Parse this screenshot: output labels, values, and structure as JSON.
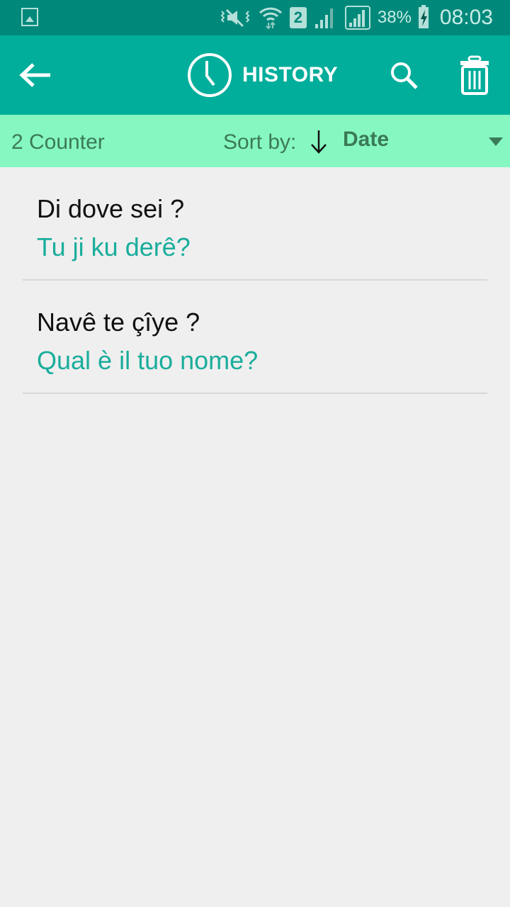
{
  "status_bar": {
    "icons": [
      "gallery-icon",
      "vibrate-mute-icon",
      "wifi-icon",
      "sim-2-icon",
      "signal-icon",
      "signal-full-icon",
      "battery-charging-icon"
    ],
    "sim_label": "2",
    "battery_percent": "38%",
    "time": "08:03"
  },
  "app_bar": {
    "title": "HISTORY",
    "icons": [
      "back-arrow-icon",
      "clock-icon",
      "search-icon",
      "trash-icon"
    ]
  },
  "sort_bar": {
    "counter": "2 Counter",
    "sort_label": "Sort by:",
    "sort_direction": "descending",
    "sort_value": "Date"
  },
  "history": [
    {
      "source": "Di dove sei ?",
      "translation": "Tu ji ku derê?"
    },
    {
      "source": "Navê te çîye ?",
      "translation": "Qual è il tuo nome?"
    }
  ],
  "colors": {
    "status_bar": "#00897b",
    "app_bar": "#00ae9b",
    "sort_bar": "#86f7c1",
    "translation_text": "#1aad9c",
    "background": "#efefef"
  }
}
